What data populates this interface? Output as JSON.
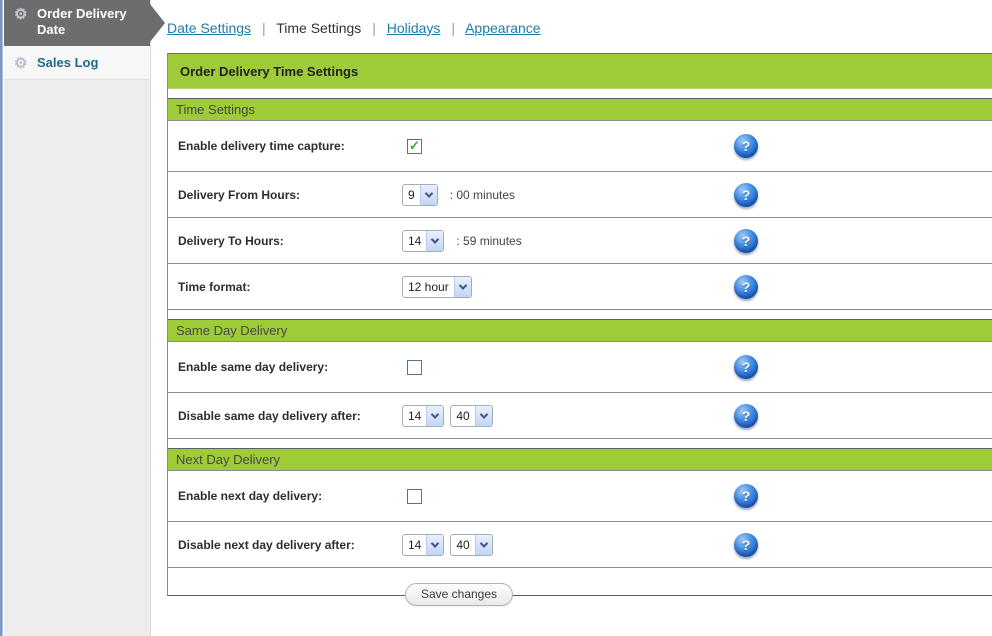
{
  "sidebar": {
    "items": [
      {
        "label": "Order Delivery Date",
        "selected": true
      },
      {
        "label": "Sales Log",
        "selected": false
      }
    ]
  },
  "tabs": {
    "separator": "|",
    "items": [
      {
        "label": "Date Settings",
        "active": false
      },
      {
        "label": "Time Settings",
        "active": true
      },
      {
        "label": "Holidays",
        "active": false
      },
      {
        "label": "Appearance",
        "active": false
      }
    ]
  },
  "panel": {
    "title": "Order Delivery Time Settings",
    "save_label": "Save changes",
    "sections": [
      {
        "title": "Time Settings",
        "rows": [
          {
            "label": "Enable delivery time capture:",
            "control": "checkbox",
            "checked": true
          },
          {
            "label": "Delivery From Hours:",
            "control": "select",
            "value": "9",
            "suffix": ": 00 minutes"
          },
          {
            "label": "Delivery To Hours:",
            "control": "select",
            "value": "14",
            "suffix": ": 59 minutes"
          },
          {
            "label": "Time format:",
            "control": "select",
            "value": "12 hour"
          }
        ]
      },
      {
        "title": "Same Day Delivery",
        "rows": [
          {
            "label": "Enable same day delivery:",
            "control": "checkbox",
            "checked": false
          },
          {
            "label": "Disable same day delivery after:",
            "control": "select-pair",
            "hour": "14",
            "minute": "40"
          }
        ]
      },
      {
        "title": "Next Day Delivery",
        "rows": [
          {
            "label": "Enable next day delivery:",
            "control": "checkbox",
            "checked": false
          },
          {
            "label": "Disable next day delivery after:",
            "control": "select-pair",
            "hour": "14",
            "minute": "40"
          }
        ]
      }
    ]
  },
  "icons": {
    "help": "?",
    "check": "✓",
    "gear": "⚙"
  },
  "colors": {
    "accent_green": "#9ecb38",
    "link_teal": "#1d7ca8",
    "help_blue": "#2069cf",
    "sidebar_selected_gray": "#6b6d6f",
    "left_strip_blue": "#7e97c3"
  }
}
